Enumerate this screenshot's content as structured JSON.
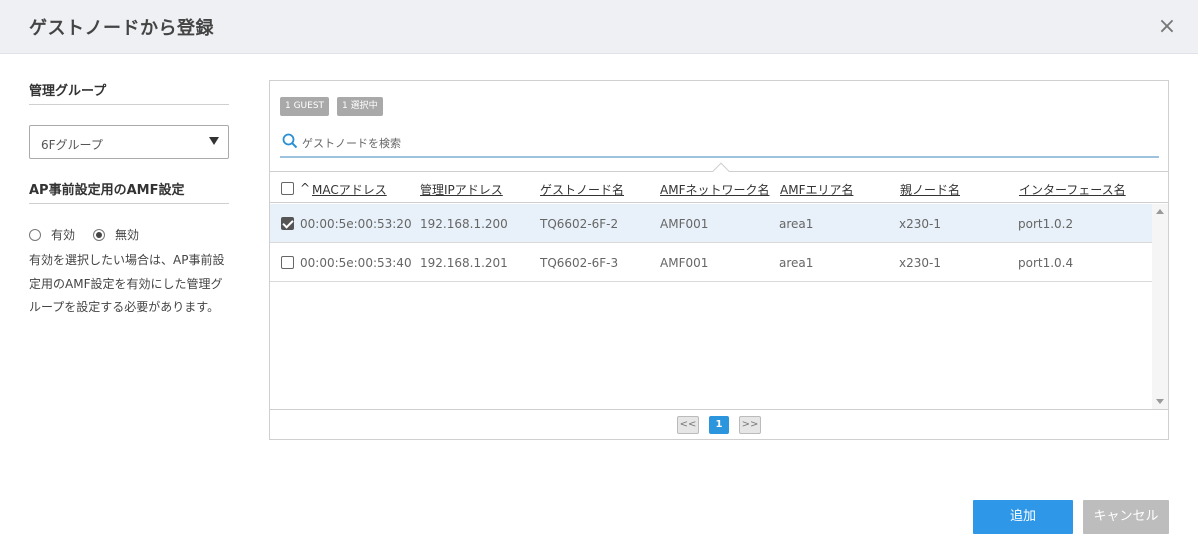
{
  "dialog": {
    "title": "ゲストノードから登録",
    "close_label": "×"
  },
  "left": {
    "group_title": "管理グループ",
    "group_select_value": "6Fグループ",
    "amf_title": "AP事前設定用のAMF設定",
    "radio_enabled": "有効",
    "radio_disabled": "無効",
    "selected_radio": "無効",
    "note": "有効を選択したい場合は、AP事前設定用のAMF設定を有効にした管理グループを設定する必要があります。"
  },
  "badges": {
    "guest": "1 GUEST",
    "selected": "1 選択中"
  },
  "search": {
    "placeholder": "ゲストノードを検索"
  },
  "table": {
    "sort_indicator": "^",
    "columns": {
      "mac": "MACアドレス",
      "ip": "管理IPアドレス",
      "guest_name": "ゲストノード名",
      "amf_network": "AMFネットワーク名",
      "amf_area": "AMFエリア名",
      "parent": "親ノード名",
      "interface": "インターフェース名"
    },
    "rows": [
      {
        "checked": true,
        "mac": "00:00:5e:00:53:20",
        "ip": "192.168.1.200",
        "guest_name": "TQ6602-6F-2",
        "amf_network": "AMF001",
        "amf_area": "area1",
        "parent": "x230-1",
        "interface": "port1.0.2"
      },
      {
        "checked": false,
        "mac": "00:00:5e:00:53:40",
        "ip": "192.168.1.201",
        "guest_name": "TQ6602-6F-3",
        "amf_network": "AMF001",
        "amf_area": "area1",
        "parent": "x230-1",
        "interface": "port1.0.4"
      }
    ]
  },
  "pager": {
    "prev": "<<",
    "current": "1",
    "next": ">>"
  },
  "buttons": {
    "add": "追加",
    "cancel": "キャンセル"
  },
  "colors": {
    "primary": "#2f97e8",
    "selected_row": "#e8f1f9",
    "header_bg": "#eef0f4"
  }
}
